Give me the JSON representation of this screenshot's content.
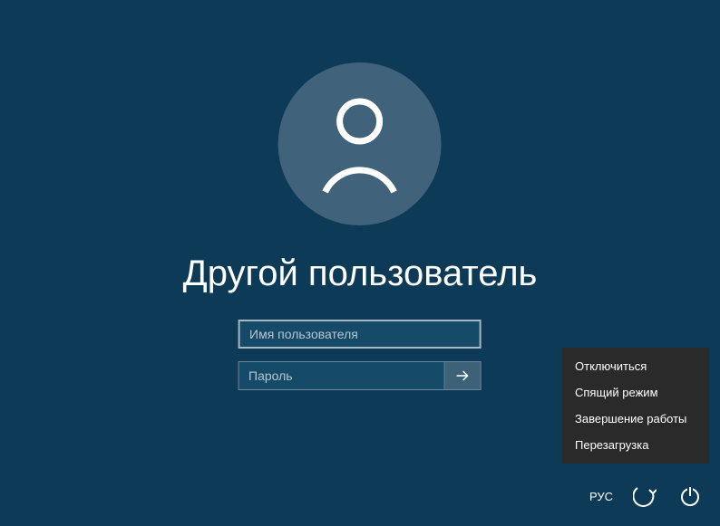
{
  "login": {
    "title": "Другой пользователь",
    "username_placeholder": "Имя пользователя",
    "password_placeholder": "Пароль"
  },
  "power_menu": {
    "items": [
      "Отключиться",
      "Спящий режим",
      "Завершение работы",
      "Перезагрузка"
    ]
  },
  "bottom": {
    "language": "РУС"
  }
}
